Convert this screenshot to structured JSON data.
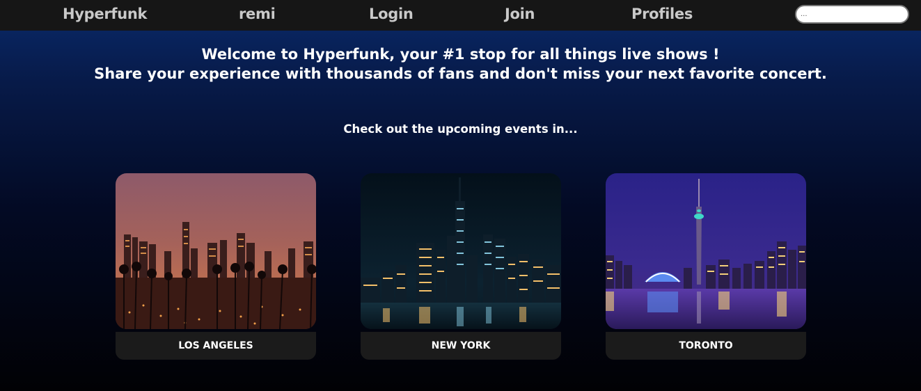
{
  "nav": {
    "brand": "Hyperfunk",
    "user": "remi",
    "login": "Login",
    "join": "Join",
    "profiles": "Profiles",
    "search_placeholder": "..."
  },
  "hero": {
    "line1": "Welcome to Hyperfunk, your #1 stop for all things live shows !",
    "line2": "Share your experience with thousands of fans and don't miss your next favorite concert."
  },
  "subtitle": "Check out the upcoming events in...",
  "cities": [
    {
      "name": "LOS ANGELES",
      "image": "los-angeles-skyline-photo"
    },
    {
      "name": "NEW YORK",
      "image": "new-york-skyline-photo"
    },
    {
      "name": "TORONTO",
      "image": "toronto-skyline-photo"
    }
  ],
  "colors": {
    "navbar": "#161616",
    "nav_text": "#c9c9c9",
    "background_top": "#0a2a6b",
    "background_bottom": "#010104",
    "card_label_bg": "#1b1b1b"
  }
}
